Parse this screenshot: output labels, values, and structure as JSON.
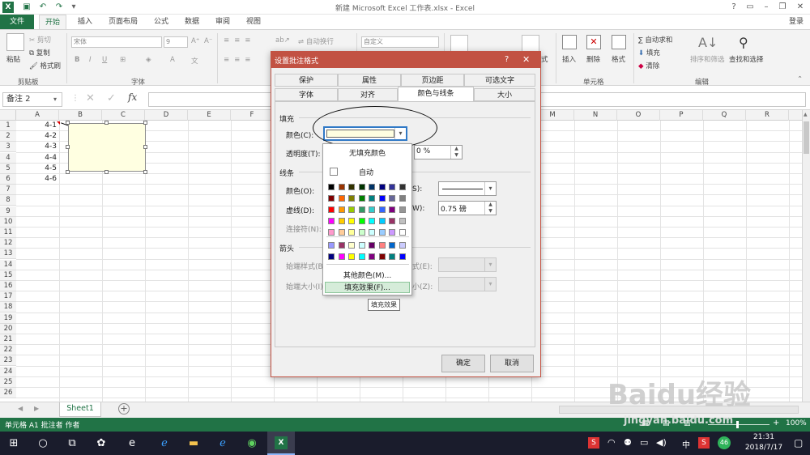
{
  "window": {
    "title": "新建 Microsoft Excel 工作表.xlsx - Excel",
    "help": "?",
    "login": "登录"
  },
  "tabs": [
    "文件",
    "开始",
    "插入",
    "页面布局",
    "公式",
    "数据",
    "审阅",
    "视图"
  ],
  "ribbon": {
    "clipboard": {
      "paste": "粘贴",
      "cut": "剪切",
      "copy": "复制",
      "painter": "格式刷",
      "label": "剪贴板"
    },
    "font": {
      "name": "宋体",
      "size": "9",
      "label": "字体",
      "bold": "B",
      "italic": "I",
      "underline": "U"
    },
    "alignment": {
      "wrap": "自动换行"
    },
    "number": {
      "format": "自定义"
    },
    "styles": {
      "partial": "式"
    },
    "cells": {
      "insert": "插入",
      "delete": "删除",
      "format": "格式",
      "label": "单元格"
    },
    "editing": {
      "autosum": "∑ 自动求和",
      "fill": "填充",
      "clear": "清除",
      "sort": "排序和筛选",
      "find": "查找和选择",
      "label": "编辑"
    }
  },
  "formula_bar": {
    "name_box": "备注 2",
    "fx": "fx",
    "cancel": "✕",
    "enter": "✓"
  },
  "grid": {
    "columns": [
      "A",
      "B",
      "C",
      "D",
      "E",
      "F",
      "G",
      "H",
      "I",
      "J",
      "K",
      "L",
      "M",
      "N",
      "O",
      "P",
      "Q",
      "R"
    ],
    "rows": [
      "1",
      "2",
      "3",
      "4",
      "5",
      "6",
      "7",
      "8",
      "9",
      "10",
      "11",
      "12",
      "13",
      "14",
      "15",
      "16",
      "17",
      "18",
      "19",
      "20",
      "21",
      "22",
      "23",
      "24",
      "25",
      "26"
    ],
    "values_a": [
      "4-1",
      "4-2",
      "4-3",
      "4-4",
      "4-5",
      "4-6"
    ]
  },
  "sheet_tabs": {
    "sheet1": "Sheet1",
    "add": "+"
  },
  "status": {
    "text": "单元格 A1 批注者 作者",
    "zoom": "100%",
    "minus": "-",
    "plus": "+"
  },
  "dialog": {
    "title": "设置批注格式",
    "help": "?",
    "close": "✕",
    "tabs_row1": [
      "保护",
      "属性",
      "页边距",
      "可选文字"
    ],
    "tabs_row2": [
      "字体",
      "对齐",
      "颜色与线条",
      "大小"
    ],
    "active_tab": "颜色与线条",
    "fill": {
      "header": "填充",
      "color_label": "颜色(C):",
      "transparency_label": "透明度(T):",
      "transparency_value": "0 %"
    },
    "line": {
      "header": "线条",
      "color_label": "颜色(O):",
      "dash_label": "虚线(D):",
      "connector_label": "连接符(N):",
      "style_label": "S):",
      "weight_label": "W):",
      "weight_value": "0.75 磅"
    },
    "arrows": {
      "header": "箭头",
      "begin_style": "始端样式(B)",
      "begin_size": "始端大小(I):",
      "end_style": "式(E):",
      "end_size": "小(Z):"
    },
    "ok": "确定",
    "cancel": "取消"
  },
  "color_dropdown": {
    "no_fill": "无填充颜色",
    "auto": "自动",
    "more_colors": "其他颜色(M)...",
    "fill_effects": "填充效果(F)...",
    "tooltip": "填充效果",
    "palette": [
      [
        "#000000",
        "#993300",
        "#333300",
        "#003300",
        "#003366",
        "#000080",
        "#333399",
        "#333333"
      ],
      [
        "#800000",
        "#ff6600",
        "#808000",
        "#008000",
        "#008080",
        "#0000ff",
        "#666699",
        "#808080"
      ],
      [
        "#ff0000",
        "#ff9900",
        "#99cc00",
        "#339966",
        "#33cccc",
        "#3366ff",
        "#800080",
        "#969696"
      ],
      [
        "#ff00ff",
        "#ffcc00",
        "#ffff00",
        "#00ff00",
        "#00ffff",
        "#00ccff",
        "#993366",
        "#c0c0c0"
      ],
      [
        "#ff99cc",
        "#ffcc99",
        "#ffff99",
        "#ccffcc",
        "#ccffff",
        "#99ccff",
        "#cc99ff",
        "#ffffff"
      ]
    ],
    "palette2": [
      [
        "#9999ff",
        "#993366",
        "#ffffcc",
        "#ccffff",
        "#660066",
        "#ff8080",
        "#0066cc",
        "#ccccff"
      ],
      [
        "#000080",
        "#ff00ff",
        "#ffff00",
        "#00ffff",
        "#800080",
        "#800000",
        "#008080",
        "#0000ff"
      ]
    ]
  },
  "taskbar": {
    "time": "21:31",
    "date": "2018/7/17",
    "lang": "中",
    "badge": "46"
  },
  "watermark": {
    "brand": "Baidu经验",
    "url": "jingyan.baidu.com"
  }
}
